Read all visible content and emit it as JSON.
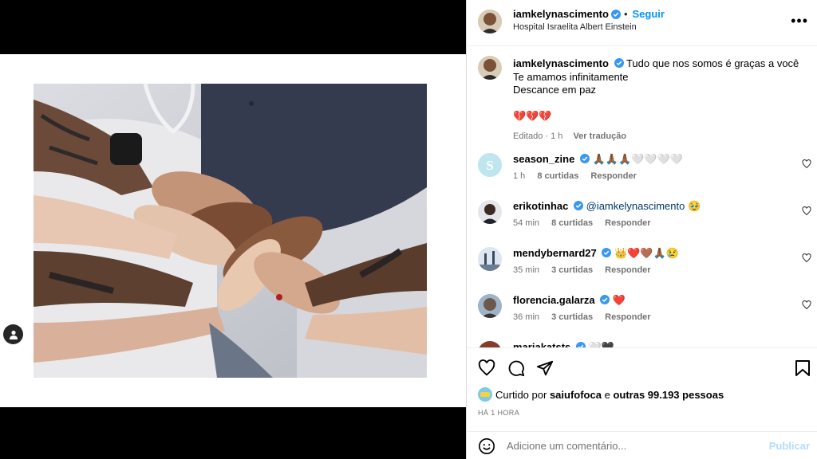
{
  "post": {
    "username": "iamkelynascimento",
    "follow_label": "Seguir",
    "location": "Hospital Israelita Albert Einstein",
    "more_label": "•••"
  },
  "caption": {
    "username": "iamkelynascimento",
    "line1": "Tudo que nos somos é graças a você",
    "line2": "Te amamos infinitamente",
    "line3": "Descance em paz",
    "emojis": "💔💔💔",
    "edited": "Editado · 1 h",
    "translate": "Ver tradução"
  },
  "comments": [
    {
      "username": "season_zine",
      "text": "🙏🏾🙏🏾🙏🏾🤍🤍🤍🤍",
      "time": "1 h",
      "likes": "8 curtidas",
      "reply": "Responder",
      "avatar_color": "#bfe6ee"
    },
    {
      "username": "erikotinhac",
      "text": "@iamkelynascimento 🥹",
      "time": "54 min",
      "likes": "8 curtidas",
      "reply": "Responder",
      "avatar_color": "#2a2f3a"
    },
    {
      "username": "mendybernard27",
      "text": "👑❤️🤎🙏🏾😢",
      "time": "35 min",
      "likes": "3 curtidas",
      "reply": "Responder",
      "avatar_color": "#8a9bb0"
    },
    {
      "username": "florencia.galarza",
      "text": "❤️",
      "time": "36 min",
      "likes": "3 curtidas",
      "reply": "Responder",
      "avatar_color": "#6b5a4c"
    },
    {
      "username": "mariakatsts",
      "text": "🤍🖤",
      "time": "",
      "likes": "",
      "reply": "",
      "avatar_color": "#8a3a2a"
    }
  ],
  "likes": {
    "prefix": "Curtido por",
    "user": "saiufofoca",
    "middle": "e",
    "others": "outras 99.193 pessoas"
  },
  "time_ago": "HÁ 1 HORA",
  "add_comment": {
    "placeholder": "Adicione um comentário...",
    "publish": "Publicar"
  },
  "colors": {
    "accent": "#0095f6",
    "verified": "#3897f0",
    "publish_disabled": "#b3dbff"
  }
}
